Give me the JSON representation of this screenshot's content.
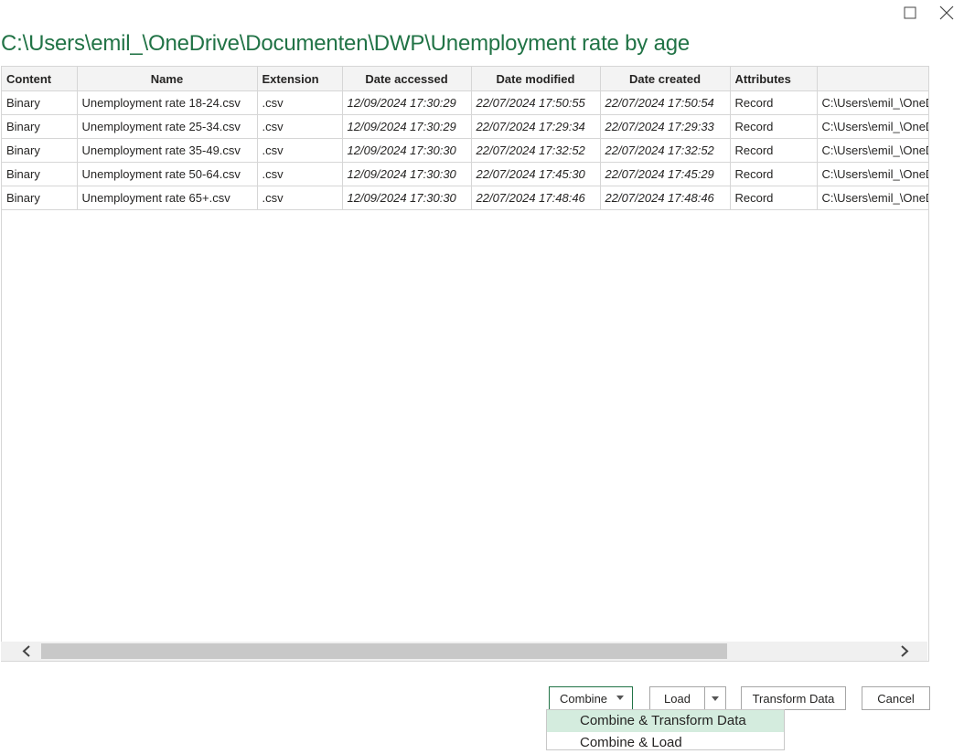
{
  "window": {
    "title_path": "C:\\Users\\emil_\\OneDrive\\Documenten\\DWP\\Unemployment rate by age"
  },
  "table": {
    "columns": [
      "Content",
      "Name",
      "Extension",
      "Date accessed",
      "Date modified",
      "Date created",
      "Attributes",
      ""
    ],
    "rows": [
      [
        "Binary",
        "Unemployment rate 18-24.csv",
        ".csv",
        "12/09/2024 17:30:29",
        "22/07/2024 17:50:55",
        "22/07/2024 17:50:54",
        "Record",
        "C:\\Users\\emil_\\OneDrive"
      ],
      [
        "Binary",
        "Unemployment rate 25-34.csv",
        ".csv",
        "12/09/2024 17:30:29",
        "22/07/2024 17:29:34",
        "22/07/2024 17:29:33",
        "Record",
        "C:\\Users\\emil_\\OneDrive"
      ],
      [
        "Binary",
        "Unemployment rate 35-49.csv",
        ".csv",
        "12/09/2024 17:30:30",
        "22/07/2024 17:32:52",
        "22/07/2024 17:32:52",
        "Record",
        "C:\\Users\\emil_\\OneDrive"
      ],
      [
        "Binary",
        "Unemployment rate 50-64.csv",
        ".csv",
        "12/09/2024 17:30:30",
        "22/07/2024 17:45:30",
        "22/07/2024 17:45:29",
        "Record",
        "C:\\Users\\emil_\\OneDrive"
      ],
      [
        "Binary",
        "Unemployment rate 65+.csv",
        ".csv",
        "12/09/2024 17:30:30",
        "22/07/2024 17:48:46",
        "22/07/2024 17:48:46",
        "Record",
        "C:\\Users\\emil_\\OneDrive"
      ]
    ]
  },
  "buttons": {
    "combine": "Combine",
    "load": "Load",
    "transform": "Transform Data",
    "cancel": "Cancel"
  },
  "combine_menu": {
    "items": [
      "Combine & Transform Data",
      "Combine & Load"
    ]
  },
  "icons": {
    "maximize": "maximize-icon",
    "close": "close-icon",
    "scroll_left": "chevron-left-icon",
    "scroll_right": "chevron-right-icon"
  },
  "colors": {
    "accent": "#217346",
    "menu_highlight": "#d4ecde"
  }
}
